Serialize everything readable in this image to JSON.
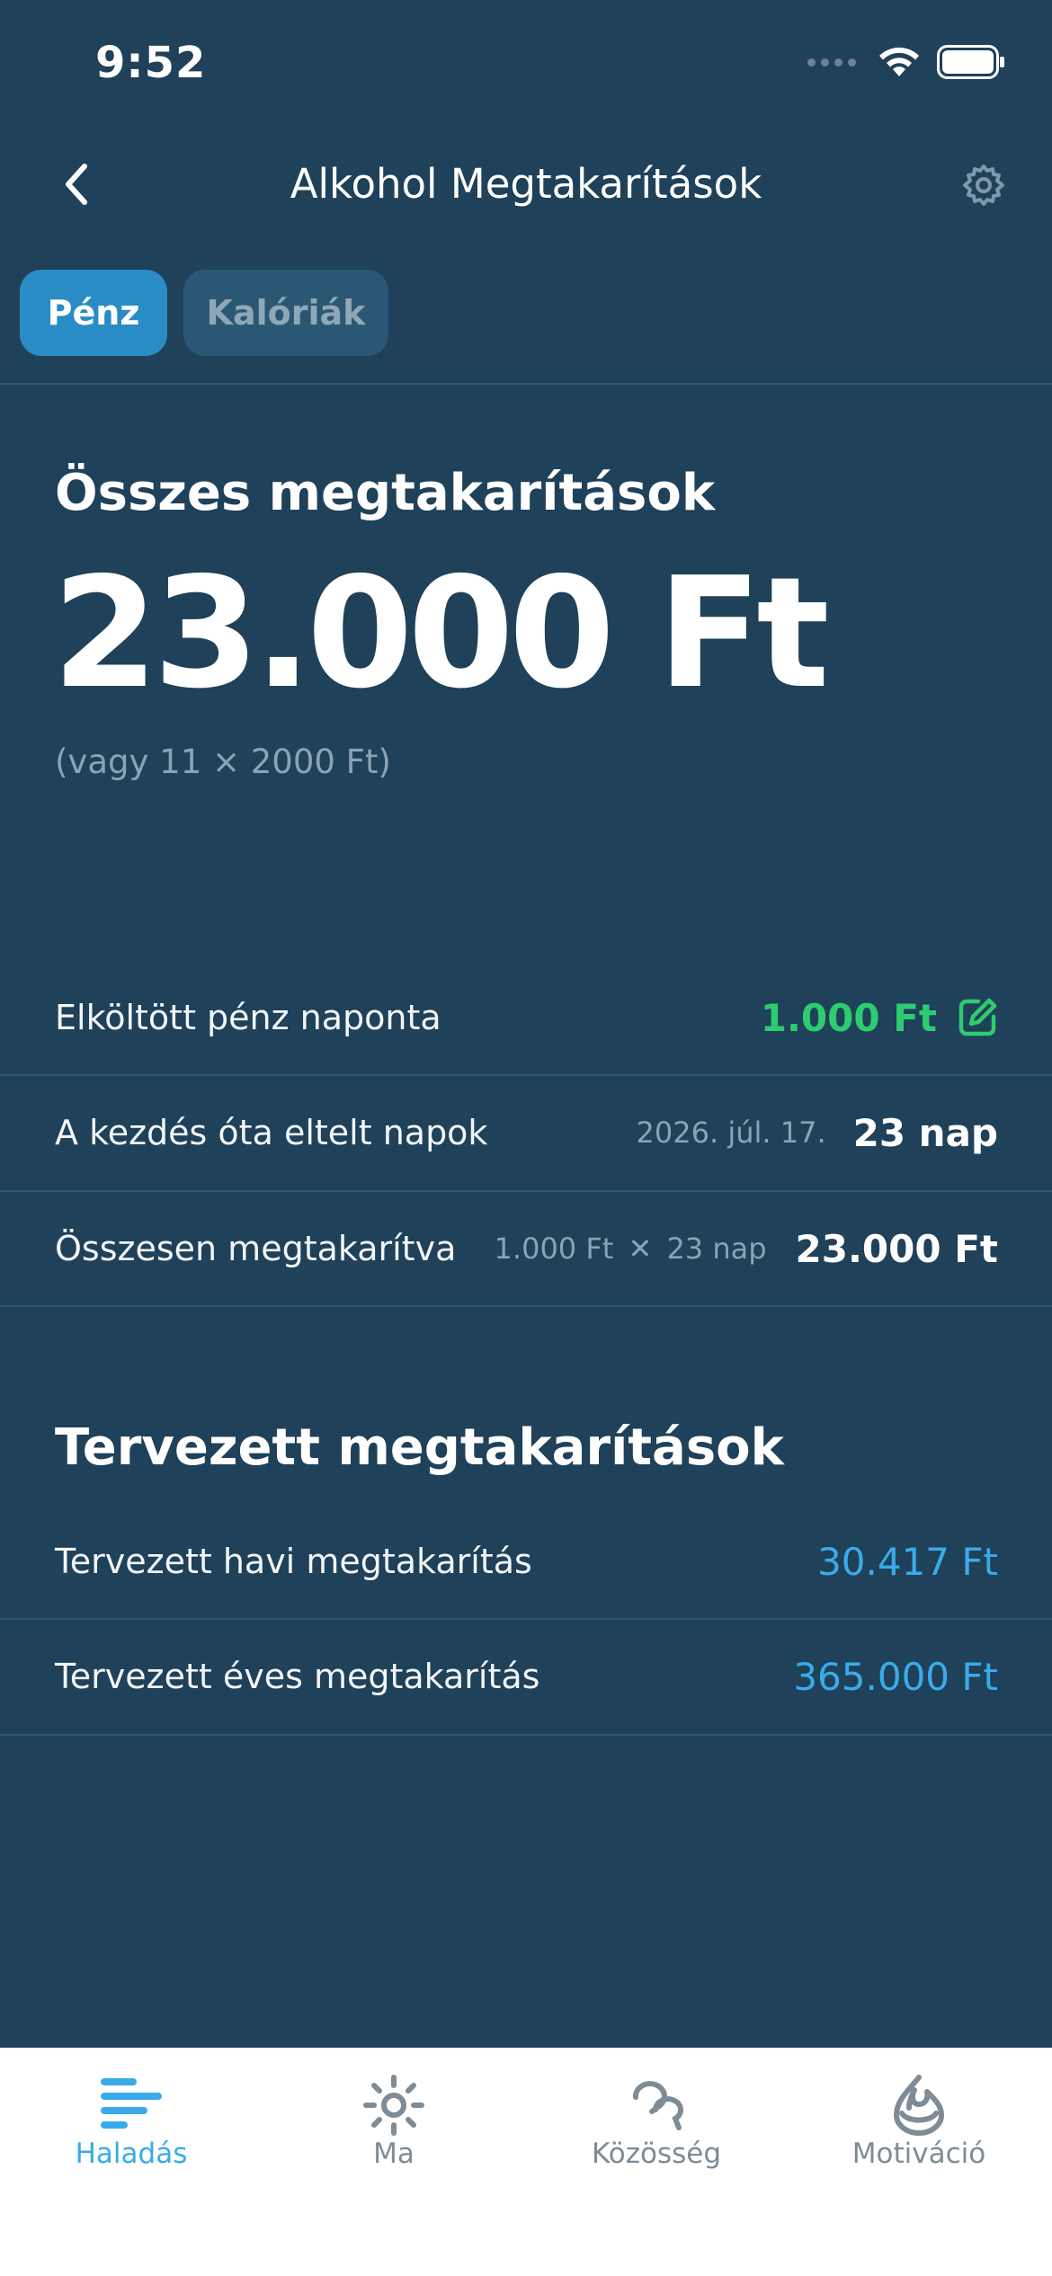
{
  "status_bar": {
    "time": "9:52"
  },
  "nav": {
    "title": "Alkohol Megtakarítások"
  },
  "segments": {
    "money": "Pénz",
    "calories": "Kalóriák"
  },
  "total": {
    "title": "Összes megtakarítások",
    "amount": "23.000 Ft",
    "note": "(vagy 11 × 2000 Ft)"
  },
  "details": {
    "spent_per_day": {
      "label": "Elköltött pénz naponta",
      "value": "1.000 Ft"
    },
    "days_elapsed": {
      "label": "A kezdés óta eltelt napok",
      "date": "2026. júl. 17.",
      "value": "23 nap"
    },
    "total_saved": {
      "label": "Összesen megtakarítva",
      "formula_a": "1.000 Ft",
      "formula_sign": "✕",
      "formula_b": "23 nap",
      "value": "23.000 Ft"
    }
  },
  "planned": {
    "title": "Tervezett megtakarítások",
    "monthly": {
      "label": "Tervezett havi megtakarítás",
      "value": "30.417 Ft"
    },
    "yearly": {
      "label": "Tervezett éves megtakarítás",
      "value": "365.000 Ft"
    }
  },
  "tabs": [
    {
      "label": "Haladás",
      "icon": "progress-bars-icon"
    },
    {
      "label": "Ma",
      "icon": "sun-icon"
    },
    {
      "label": "Közösség",
      "icon": "community-icon"
    },
    {
      "label": "Motiváció",
      "icon": "motivation-icon"
    }
  ],
  "colors": {
    "background": "#1f4159",
    "accent_blue": "#3aabea",
    "accent_green": "#2ecc71",
    "segment_active": "#2a8cc4"
  }
}
